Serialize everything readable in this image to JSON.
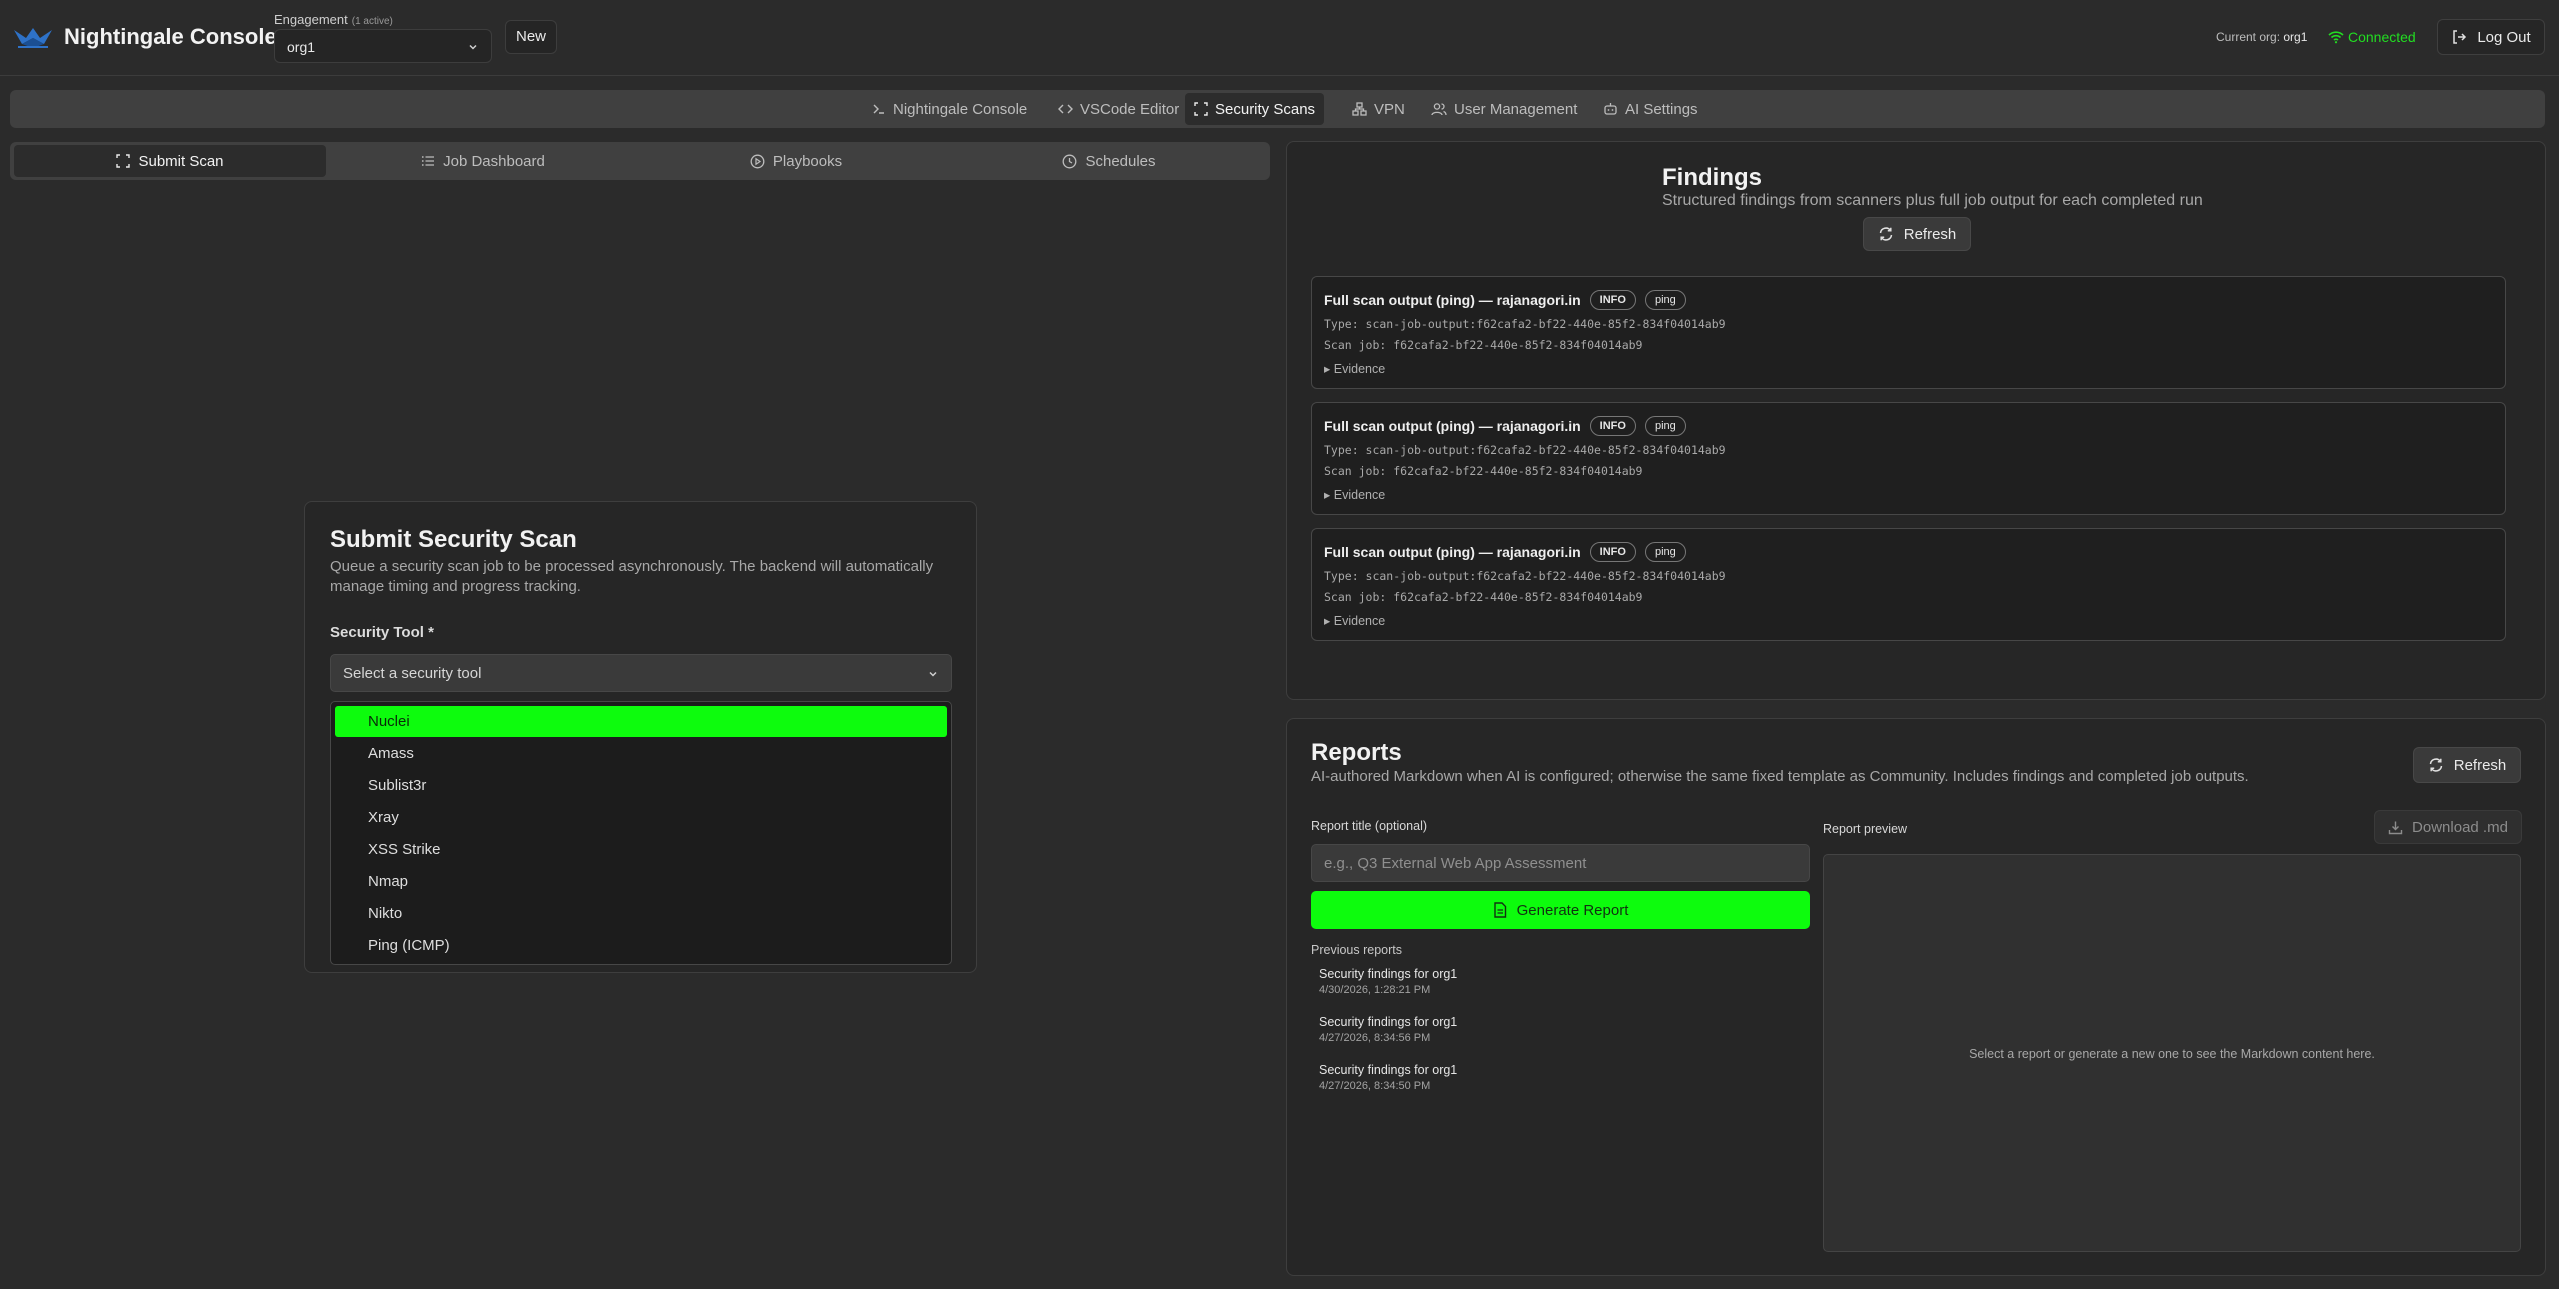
{
  "header": {
    "app_title": "Nightingale Console",
    "engagement_label": "Engagement",
    "engagement_sub": "(1 active)",
    "engagement_value": "org1",
    "new_label": "New",
    "current_org_prefix": "Current org:",
    "current_org_value": "org1",
    "connection_status": "Connected",
    "logout_label": "Log Out"
  },
  "nav": {
    "tabs": [
      {
        "label": "Nightingale Console",
        "icon": "terminal-icon"
      },
      {
        "label": "VSCode Editor",
        "icon": "code-icon"
      },
      {
        "label": "Security Scans",
        "icon": "scan-icon",
        "active": true
      },
      {
        "label": "VPN",
        "icon": "network-icon"
      },
      {
        "label": "User Management",
        "icon": "users-icon"
      },
      {
        "label": "AI Settings",
        "icon": "bot-icon"
      }
    ]
  },
  "subtabs": [
    {
      "label": "Submit Scan",
      "icon": "scan-icon",
      "active": true
    },
    {
      "label": "Job Dashboard",
      "icon": "list-icon"
    },
    {
      "label": "Playbooks",
      "icon": "play-circle-icon"
    },
    {
      "label": "Schedules",
      "icon": "clock-icon"
    }
  ],
  "scan": {
    "title": "Submit Security Scan",
    "description": "Queue a security scan job to be processed asynchronously. The backend will automatically manage timing and progress tracking.",
    "tool_label": "Security Tool *",
    "tool_placeholder": "Select a security tool",
    "tool_options": [
      "Nuclei",
      "Amass",
      "Sublist3r",
      "Xray",
      "XSS Strike",
      "Nmap",
      "Nikto",
      "Ping (ICMP)"
    ],
    "highlighted_option": "Nuclei"
  },
  "findings": {
    "title": "Findings",
    "description": "Structured findings from scanners plus full job output for each completed run",
    "refresh_label": "Refresh",
    "items": [
      {
        "title": "Full scan output (ping) — rajanagori.in",
        "severity": "INFO",
        "tool": "ping",
        "type": "Type: scan-job-output:f62cafa2-bf22-440e-85f2-834f04014ab9",
        "job": "Scan job: f62cafa2-bf22-440e-85f2-834f04014ab9",
        "evidence_label": "Evidence"
      },
      {
        "title": "Full scan output (ping) — rajanagori.in",
        "severity": "INFO",
        "tool": "ping",
        "type": "Type: scan-job-output:f62cafa2-bf22-440e-85f2-834f04014ab9",
        "job": "Scan job: f62cafa2-bf22-440e-85f2-834f04014ab9",
        "evidence_label": "Evidence"
      },
      {
        "title": "Full scan output (ping) — rajanagori.in",
        "severity": "INFO",
        "tool": "ping",
        "type": "Type: scan-job-output:f62cafa2-bf22-440e-85f2-834f04014ab9",
        "job": "Scan job: f62cafa2-bf22-440e-85f2-834f04014ab9",
        "evidence_label": "Evidence"
      }
    ]
  },
  "reports": {
    "title": "Reports",
    "description": "AI-authored Markdown when AI is configured; otherwise the same fixed template as Community. Includes findings and completed job outputs.",
    "refresh_label": "Refresh",
    "report_title_label": "Report title (optional)",
    "report_title_placeholder": "e.g., Q3 External Web App Assessment",
    "generate_label": "Generate Report",
    "previous_label": "Previous reports",
    "previous": [
      {
        "title": "Security findings for org1",
        "date": "4/30/2026, 1:28:21 PM"
      },
      {
        "title": "Security findings for org1",
        "date": "4/27/2026, 8:34:56 PM"
      },
      {
        "title": "Security findings for org1",
        "date": "4/27/2026, 8:34:50 PM"
      }
    ],
    "preview_label": "Report preview",
    "download_label": "Download .md",
    "preview_empty": "Select a report or generate a new one to see the Markdown content here."
  },
  "colors": {
    "accent_green": "#0dfc0d",
    "connected_green": "#22dd22",
    "background": "#2b2b2b",
    "panel": "#262626"
  }
}
